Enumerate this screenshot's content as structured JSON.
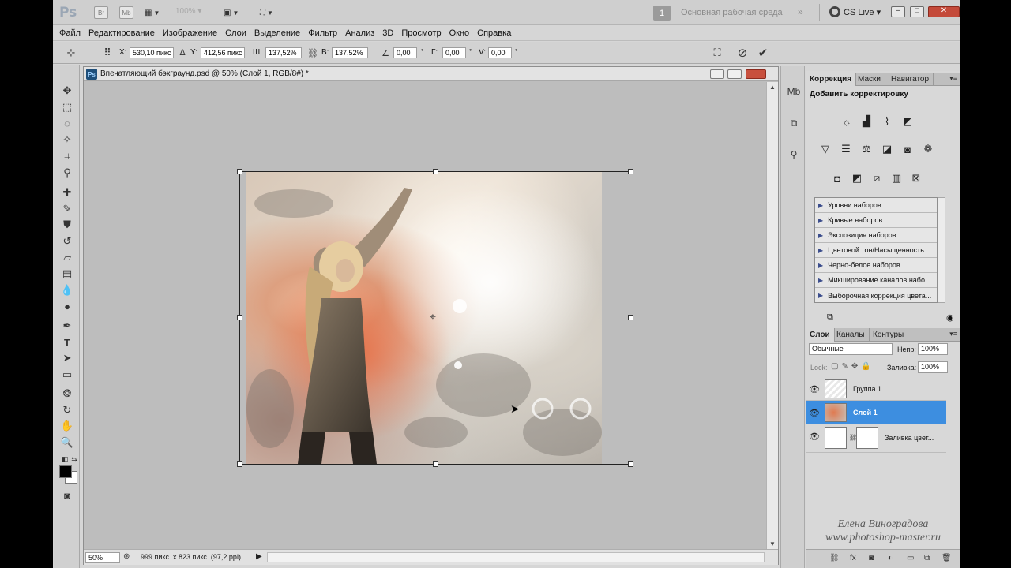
{
  "app": {
    "logo": "Ps",
    "bridge_label": "Br",
    "minibridge_label": "Mb",
    "zoom_value": "100%"
  },
  "workspace": {
    "number": "1",
    "name": "Основная рабочая среда",
    "more": "»"
  },
  "cslive": {
    "label": "CS Live ▾"
  },
  "menu": [
    "Файл",
    "Редактирование",
    "Изображение",
    "Слои",
    "Выделение",
    "Фильтр",
    "Анализ",
    "3D",
    "Просмотр",
    "Окно",
    "Справка"
  ],
  "options": {
    "x_label": "X:",
    "x_value": "530,10 пикс",
    "y_label": "Y:",
    "y_value": "412,56 пикс",
    "w_label": "Ш:",
    "w_value": "137,52%",
    "h_label": "В:",
    "h_value": "137,52%",
    "angle_value": "0,00",
    "h_skew_label": "Г:",
    "h_skew_value": "0,00",
    "v_skew_label": "V:",
    "v_skew_value": "0,00"
  },
  "document": {
    "title": "Впечатляющий бэкграунд.psd @ 50% (Слой 1, RGB/8#) *",
    "zoom": "50%",
    "info": "999 пикс. x 823 пикс. (97,2 ppi)"
  },
  "adjustments_panel": {
    "tabs": [
      "Коррекция",
      "Маски",
      "Навигатор"
    ],
    "title": "Добавить корректировку",
    "presets": [
      "Уровни наборов",
      "Кривые наборов",
      "Экспозиция наборов",
      "Цветовой тон/Насыщенность...",
      "Черно-белое наборов",
      "Микширование каналов набо...",
      "Выборочная коррекция цвета..."
    ]
  },
  "layers_panel": {
    "tabs": [
      "Слои",
      "Каналы",
      "Контуры"
    ],
    "blend_mode": "Обычные",
    "opacity_label": "Непр:",
    "opacity_value": "100%",
    "lock_label": "Lock:",
    "fill_label": "Заливка:",
    "fill_value": "100%",
    "layers": [
      {
        "name": "Группа 1",
        "active": false
      },
      {
        "name": "Слой 1",
        "active": true
      },
      {
        "name": "Заливка цвет...",
        "active": false
      }
    ]
  },
  "watermark": {
    "line1": "Елена Виноградова",
    "line2": "www.photoshop-master.ru"
  },
  "colors": {
    "selected_layer": "#3d8ee0",
    "close_button": "#c44a3a"
  }
}
